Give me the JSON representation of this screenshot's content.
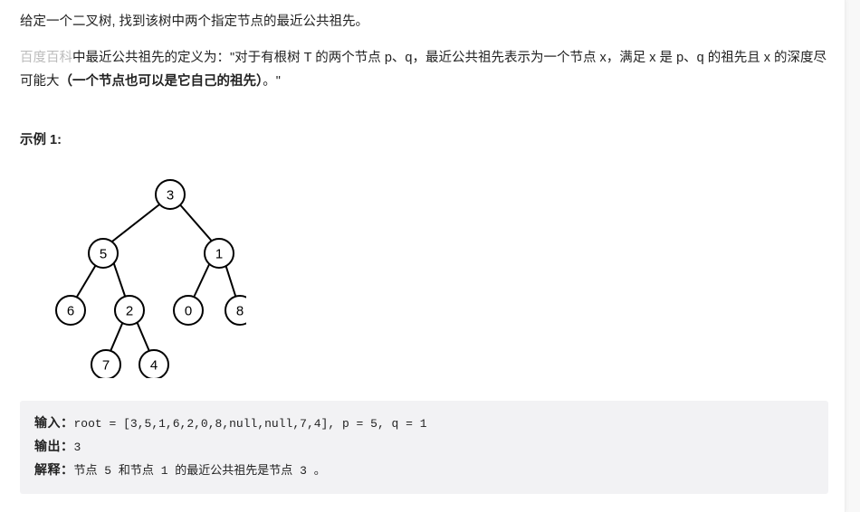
{
  "intro": "给定一个二叉树, 找到该树中两个指定节点的最近公共祖先。",
  "def": {
    "link": "百度百科",
    "part1": "中最近公共祖先的定义为：\"对于有根树 T 的两个节点 p、q，最近公共祖先表示为一个节点 x，满足 x 是 p、q 的祖先且 x 的深度尽可能大",
    "bold": "（一个节点也可以是它自己的祖先）",
    "part2": "。\""
  },
  "exampleHeading": "示例 1:",
  "treeNodes": {
    "n3": "3",
    "n5": "5",
    "n1": "1",
    "n6": "6",
    "n2": "2",
    "n0": "0",
    "n8": "8",
    "n7": "7",
    "n4": "4"
  },
  "sample": {
    "inLabel": "输入：",
    "inVal": "root = [3,5,1,6,2,0,8,null,null,7,4], p = 5, q = 1",
    "outLabel": "输出：",
    "outVal": "3",
    "expLabel": "解释：",
    "expVal": "节点 5 和节点 1 的最近公共祖先是节点 3 。"
  }
}
